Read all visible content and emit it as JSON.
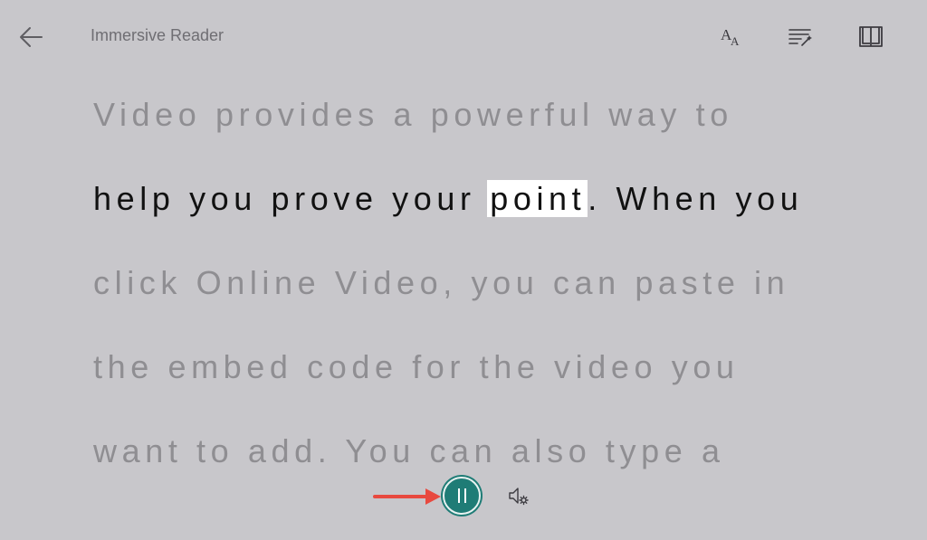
{
  "header": {
    "title": "Immersive Reader",
    "back_icon": "arrow-left-icon",
    "tools": [
      {
        "name": "text-preferences",
        "icon": "text-size-icon"
      },
      {
        "name": "grammar-options",
        "icon": "grammar-wand-icon"
      },
      {
        "name": "reading-preferences",
        "icon": "book-icon"
      }
    ]
  },
  "reader": {
    "lines": [
      "Video provides a powerful way to",
      "help you prove your ",
      "click Online Video, you can paste in",
      "the embed code for the video you",
      "want to add. You can also type a"
    ],
    "active_line_before": "help you prove your ",
    "highlighted_word": "point",
    "active_line_after": ". When you"
  },
  "playback": {
    "state": "playing",
    "pause_icon": "pause-icon",
    "voice_settings_icon": "voice-settings-icon",
    "annotation_arrow_color": "#e8493f",
    "accent_color": "#1f7c76"
  }
}
